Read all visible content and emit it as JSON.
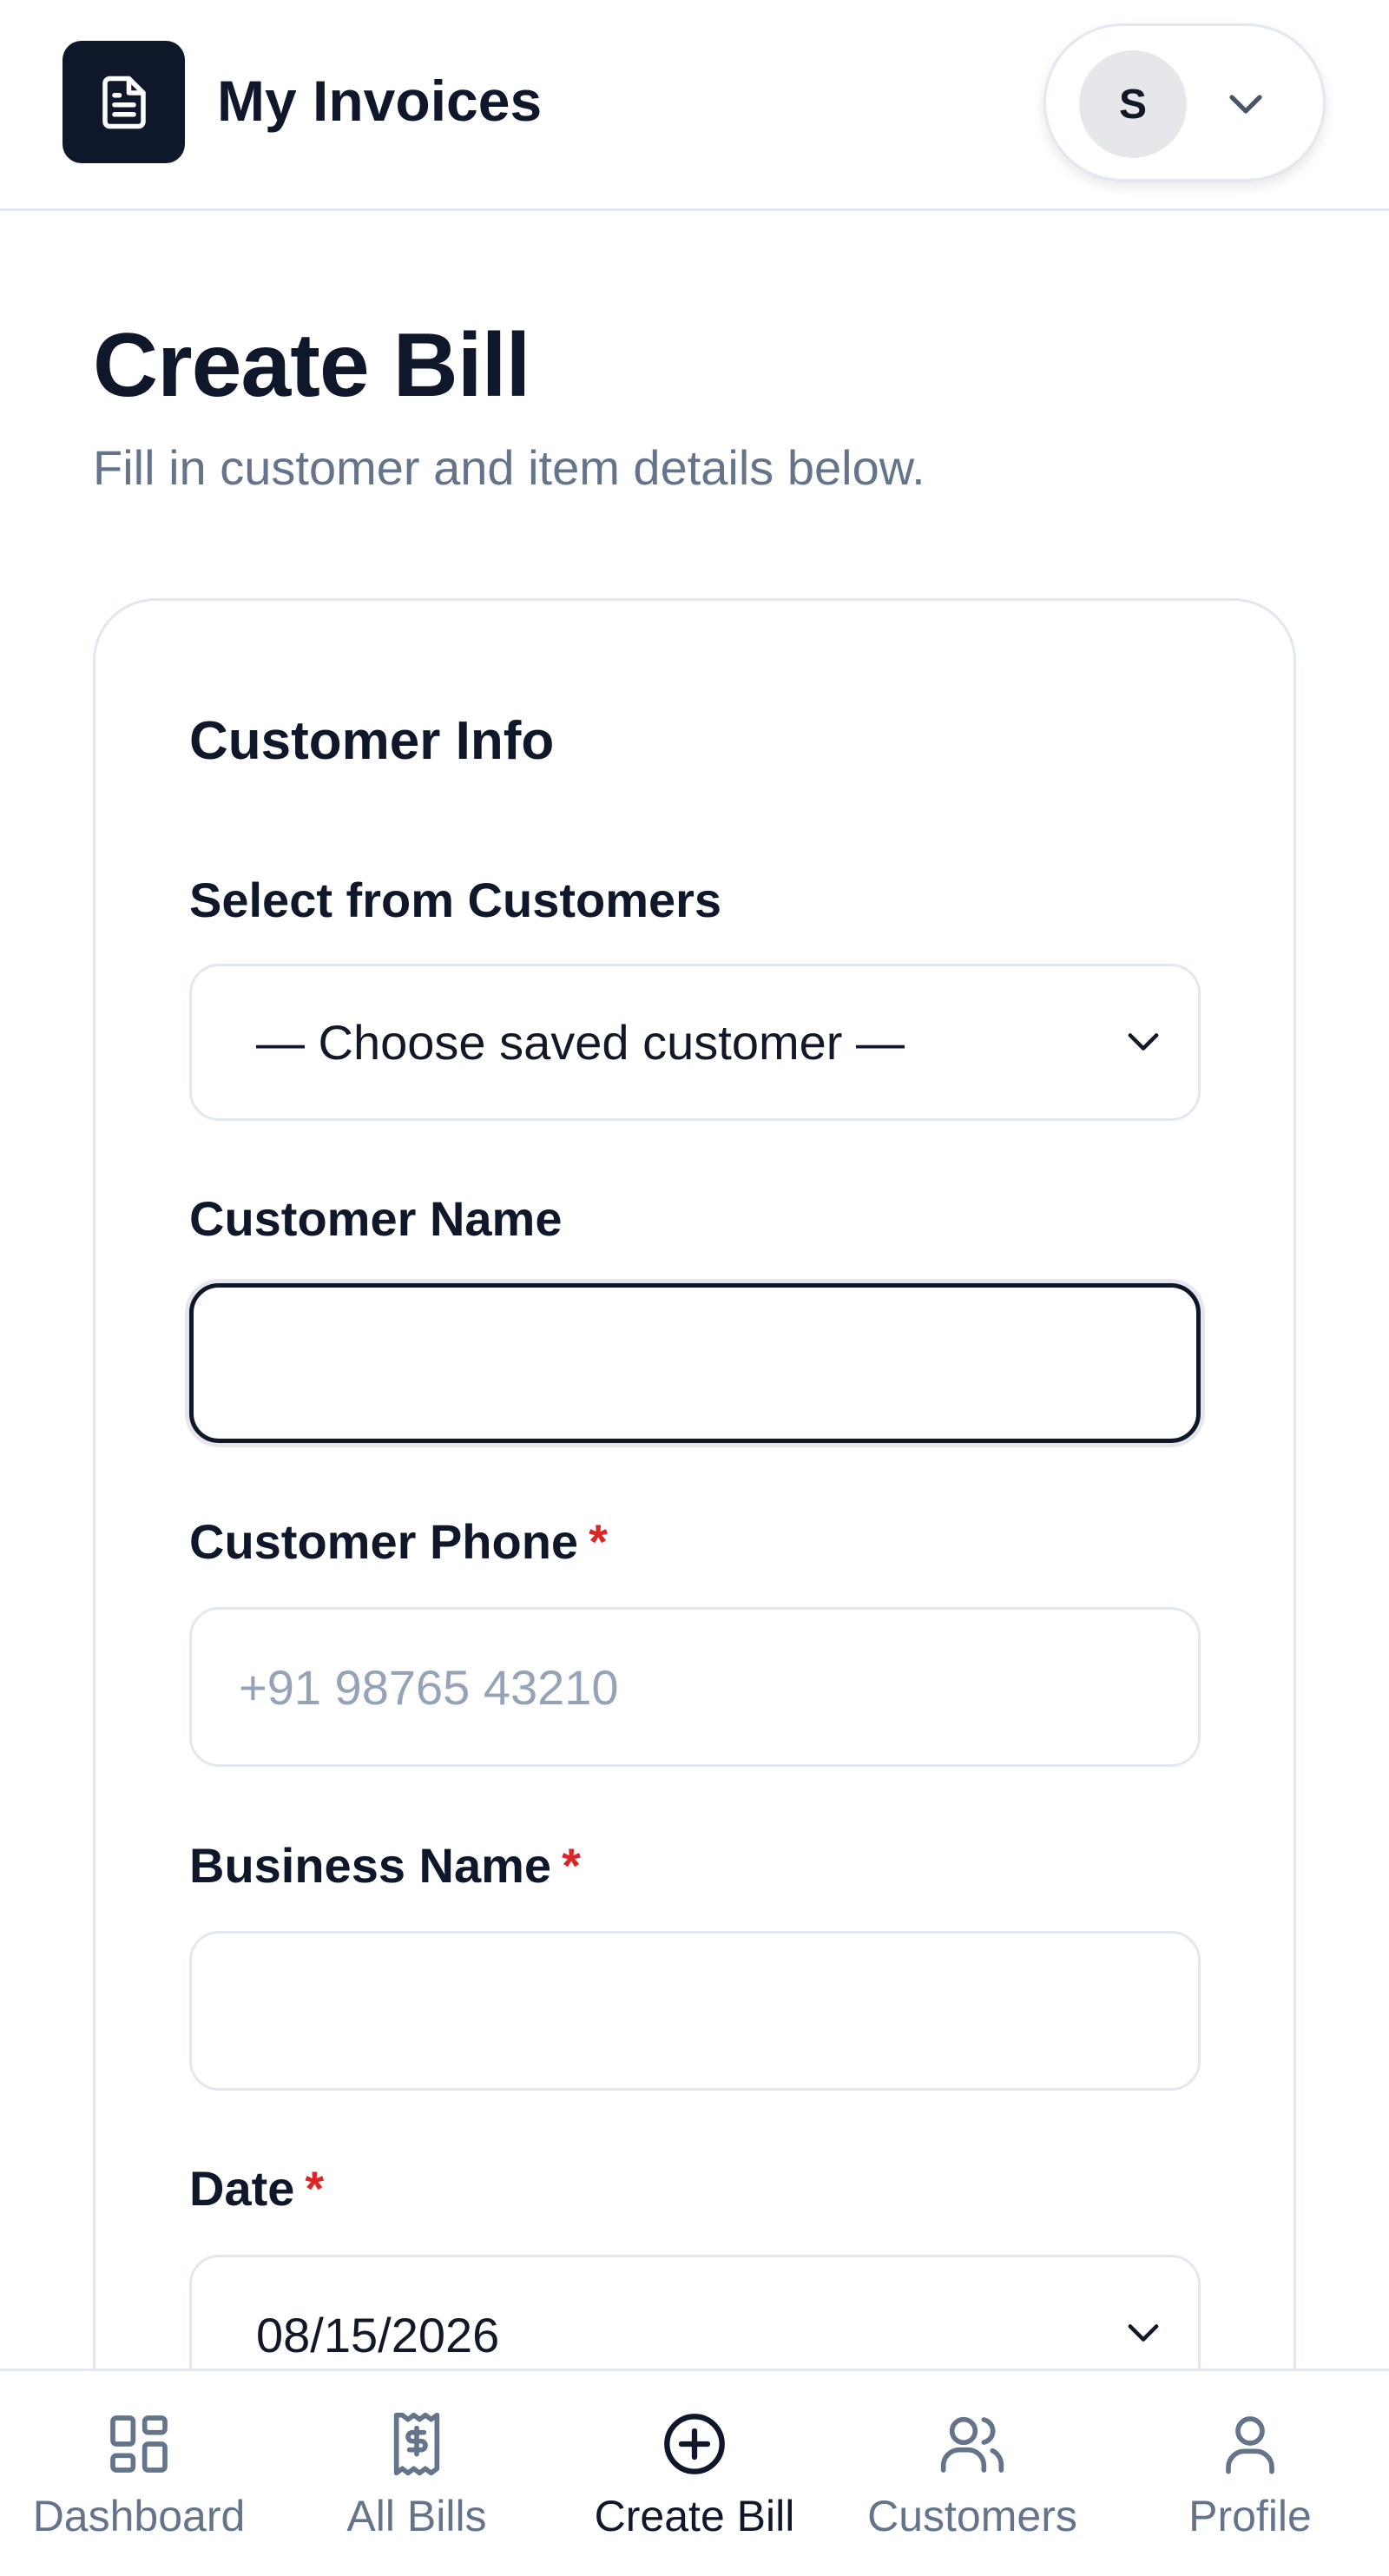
{
  "header": {
    "app_title": "My Invoices",
    "logo_icon": "document-icon",
    "user_initial": "S",
    "user_menu_icon": "chevron-down-icon"
  },
  "page": {
    "title": "Create Bill",
    "subtitle": "Fill in customer and item details below."
  },
  "form": {
    "section_title": "Customer Info",
    "select_customer": {
      "label": "Select from Customers",
      "selected": "— Choose saved customer —"
    },
    "customer_name": {
      "label": "Customer Name",
      "value": ""
    },
    "customer_phone": {
      "label": "Customer Phone",
      "required_mark": "*",
      "placeholder": "+91 98765 43210"
    },
    "business_name": {
      "label": "Business Name",
      "required_mark": "*",
      "value": ""
    },
    "date": {
      "label": "Date",
      "required_mark": "*",
      "value": "08/15/2026"
    }
  },
  "bottom_nav": {
    "items": [
      {
        "label": "Dashboard",
        "icon": "dashboard-icon",
        "active": false
      },
      {
        "label": "All Bills",
        "icon": "receipt-icon",
        "active": false
      },
      {
        "label": "Create Bill",
        "icon": "plus-circle-icon",
        "active": true
      },
      {
        "label": "Customers",
        "icon": "users-icon",
        "active": false
      },
      {
        "label": "Profile",
        "icon": "user-icon",
        "active": false
      }
    ]
  },
  "colors": {
    "primary": "#0f172a",
    "muted": "#64748b",
    "border": "#e2e8f0",
    "required": "#dc2626"
  }
}
